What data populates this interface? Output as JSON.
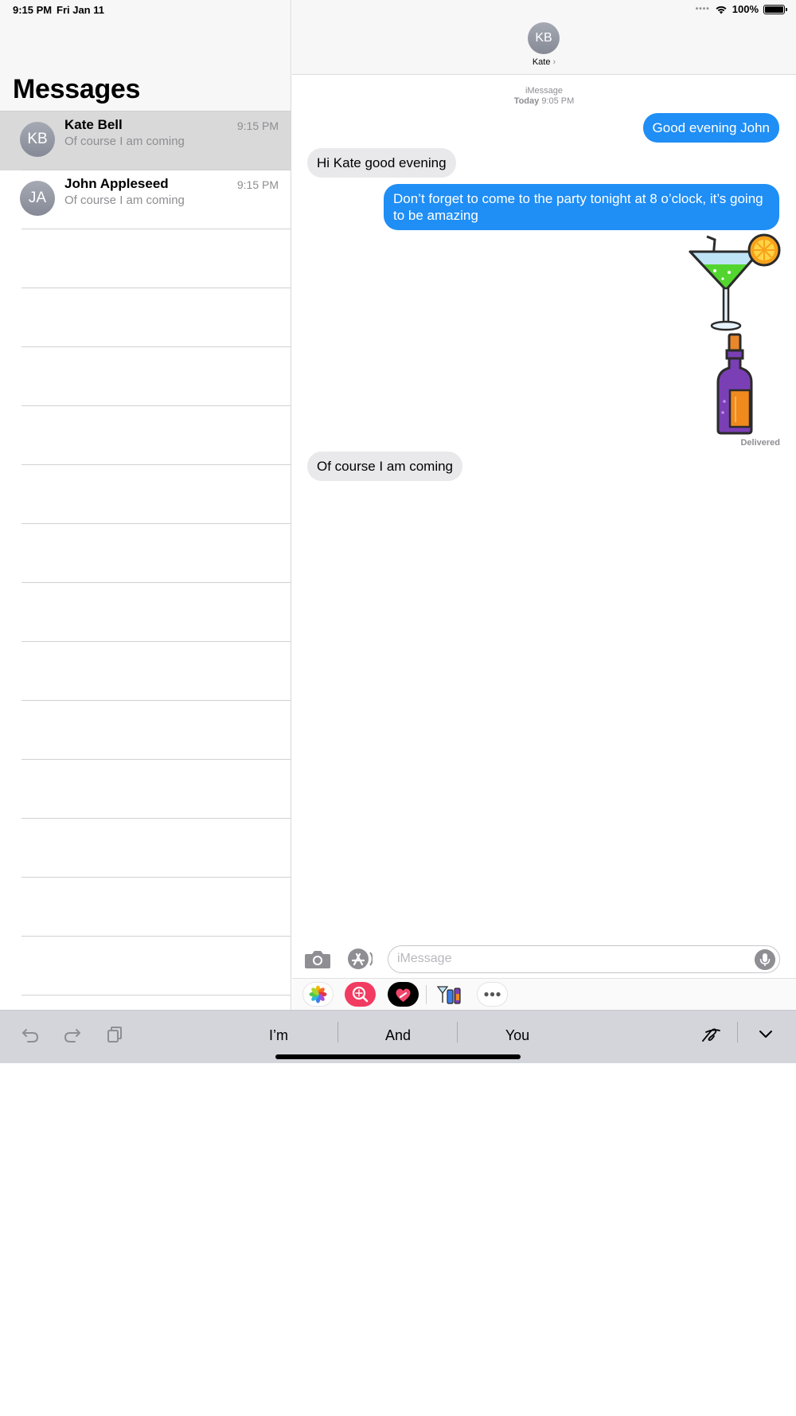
{
  "status_bar": {
    "time": "9:15 PM",
    "date": "Fri Jan 11",
    "battery": "100%"
  },
  "sidebar": {
    "title": "Messages",
    "conversations": [
      {
        "initials": "KB",
        "name": "Kate Bell",
        "preview": "Of course I am coming",
        "time": "9:15 PM",
        "selected": true
      },
      {
        "initials": "JA",
        "name": "John Appleseed",
        "preview": "Of course I am coming",
        "time": "9:15 PM",
        "selected": false
      }
    ]
  },
  "chat": {
    "contact_initials": "KB",
    "contact_name": "Kate",
    "contact_chevron": "›",
    "service": "iMessage",
    "date_prefix": "Today",
    "date_time": "9:05 PM",
    "messages": [
      {
        "direction": "outgoing",
        "text": "Good evening John"
      },
      {
        "direction": "incoming",
        "text": "Hi Kate good evening"
      },
      {
        "direction": "outgoing",
        "text": "Don’t forget to come to the party tonight at 8 o’clock, it’s going to be amazing"
      },
      {
        "direction": "outgoing",
        "sticker": "cocktail-and-bottle-sticker"
      },
      {
        "direction": "incoming",
        "text": "Of course I am coming"
      }
    ],
    "delivered_label": "Delivered",
    "input_placeholder": "iMessage"
  },
  "app_strip": [
    "photos-app-icon",
    "search-images-app-icon",
    "digital-touch-app-icon",
    "stickers-app-icon",
    "more-apps-icon"
  ],
  "keyboard_bar": {
    "suggestions": [
      "I’m",
      "And",
      "You"
    ]
  },
  "colors": {
    "outgoing_bubble": "#1f8ef5",
    "incoming_bubble": "#e9e9eb",
    "app_search": "#f23b61"
  }
}
